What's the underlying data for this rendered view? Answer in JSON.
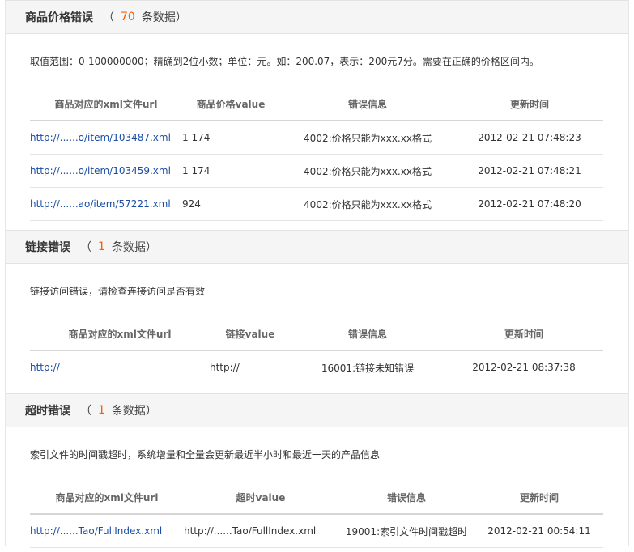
{
  "sections": [
    {
      "title": "商品价格错误",
      "count_open": "（",
      "count": "70",
      "count_unit": "条数据）",
      "description": "取值范围：0-100000000；精确到2位小数；单位：元。如：200.07，表示：200元7分。需要在正确的价格区间内。",
      "columns": [
        "商品对应的xml文件url",
        "商品价格value",
        "错误信息",
        "更新时间"
      ],
      "rows": [
        {
          "url": "http://......o/item/103487.xml",
          "value": "1 174",
          "info": "4002:价格只能为xxx.xx格式",
          "time": "2012-02-21 07:48:23"
        },
        {
          "url": "http://......o/item/103459.xml",
          "value": "1 174",
          "info": "4002:价格只能为xxx.xx格式",
          "time": "2012-02-21 07:48:21"
        },
        {
          "url": "http://......ao/item/57221.xml",
          "value": "924",
          "info": "4002:价格只能为xxx.xx格式",
          "time": "2012-02-21 07:48:20"
        }
      ]
    },
    {
      "title": "链接错误",
      "count_open": "（",
      "count": "1",
      "count_unit": "条数据）",
      "description": "链接访问错误，请检查连接访问是否有效",
      "columns": [
        "商品对应的xml文件url",
        "链接value",
        "错误信息",
        "更新时间"
      ],
      "rows": [
        {
          "url": "http://",
          "value": "http://",
          "info": "16001:链接未知错误",
          "time": "2012-02-21 08:37:38"
        }
      ]
    },
    {
      "title": "超时错误",
      "count_open": "（",
      "count": "1",
      "count_unit": "条数据）",
      "description": "索引文件的时间戳超时，系统增量和全量会更新最近半小时和最近一天的产品信息",
      "columns": [
        "商品对应的xml文件url",
        "超时value",
        "错误信息",
        "更新时间"
      ],
      "rows": [
        {
          "url": "http://......Tao/FullIndex.xml",
          "value": "http://......Tao/FullIndex.xml",
          "info": "19001:索引文件时间戳超时",
          "time": "2012-02-21 00:54:11"
        }
      ]
    }
  ],
  "colors": {
    "link": "#1a4ea6",
    "accent": "#ff5a00",
    "header_bg": "#f5f5f5"
  }
}
